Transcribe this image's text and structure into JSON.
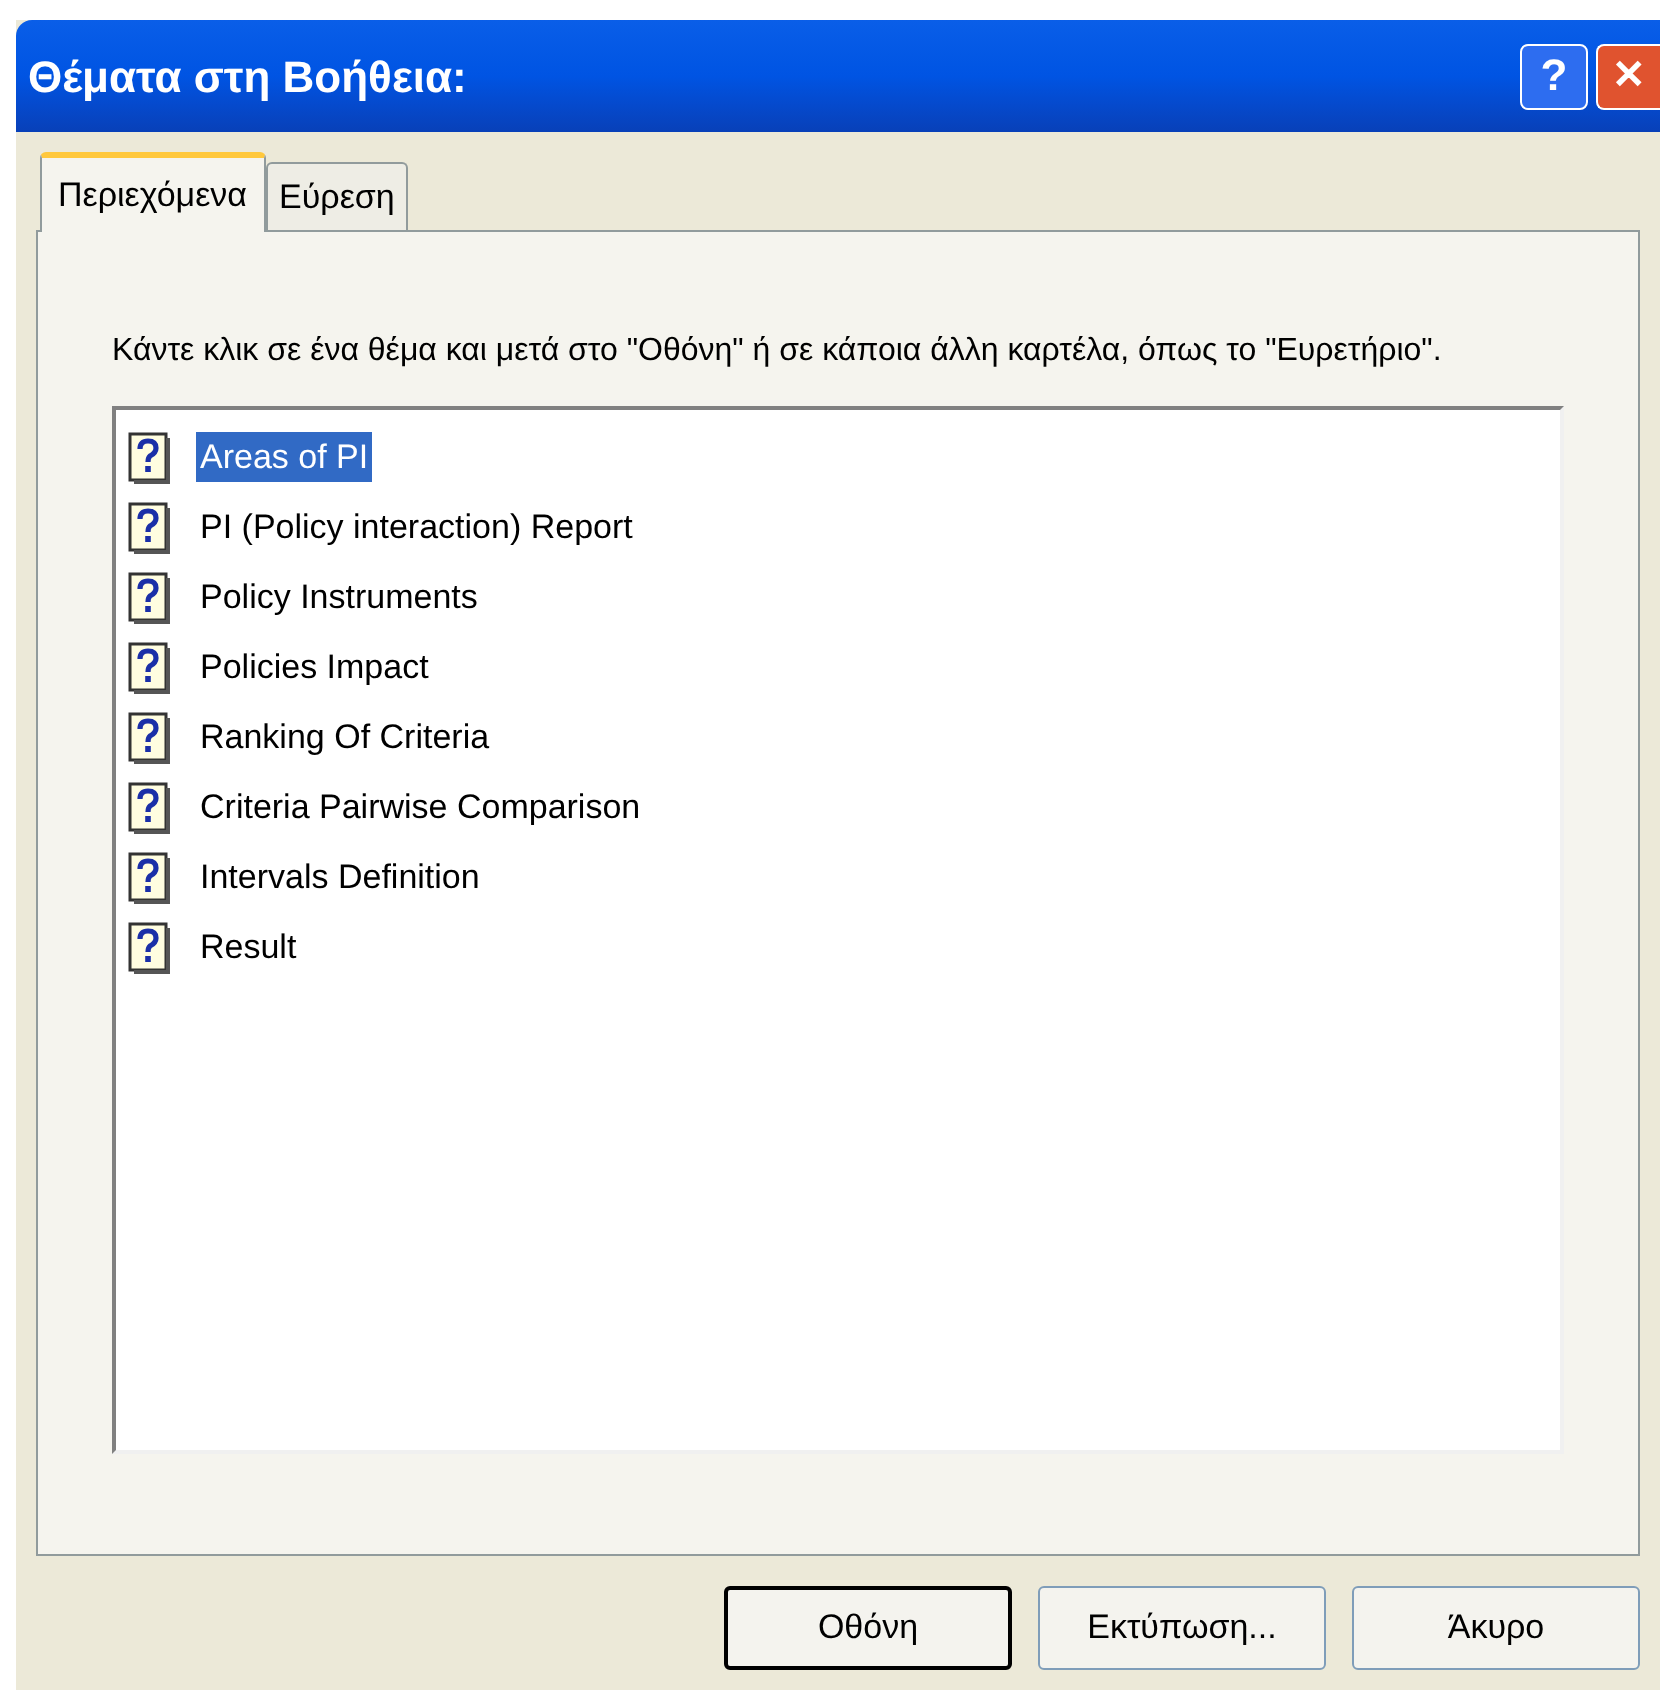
{
  "window": {
    "title": "Θέματα στη Βοήθεια:",
    "title_buttons": [
      {
        "kind": "help",
        "label": "?"
      },
      {
        "kind": "close",
        "label": "✕"
      }
    ]
  },
  "tabs": [
    {
      "label": "Περιεχόμενα",
      "selected": true
    },
    {
      "label": "Εύρεση",
      "selected": false
    }
  ],
  "instructions": "Κάντε κλικ σε ένα θέμα και μετά στο \"Οθόνη\" ή σε κάποια άλλη καρτέλα, όπως το \"Ευρετήριο\".",
  "topics": [
    {
      "label": "Areas of PI",
      "selected": true
    },
    {
      "label": "PI (Policy interaction) Report",
      "selected": false
    },
    {
      "label": "Policy Instruments",
      "selected": false
    },
    {
      "label": "Policies Impact",
      "selected": false
    },
    {
      "label": "Ranking Of Criteria",
      "selected": false
    },
    {
      "label": "Criteria Pairwise Comparison",
      "selected": false
    },
    {
      "label": "Intervals Definition",
      "selected": false
    },
    {
      "label": "Result",
      "selected": false
    }
  ],
  "buttons": [
    {
      "label": "Οθόνη",
      "default": true
    },
    {
      "label": "Εκτύπωση...",
      "default": false
    },
    {
      "label": "Άκυρο",
      "default": false
    }
  ]
}
